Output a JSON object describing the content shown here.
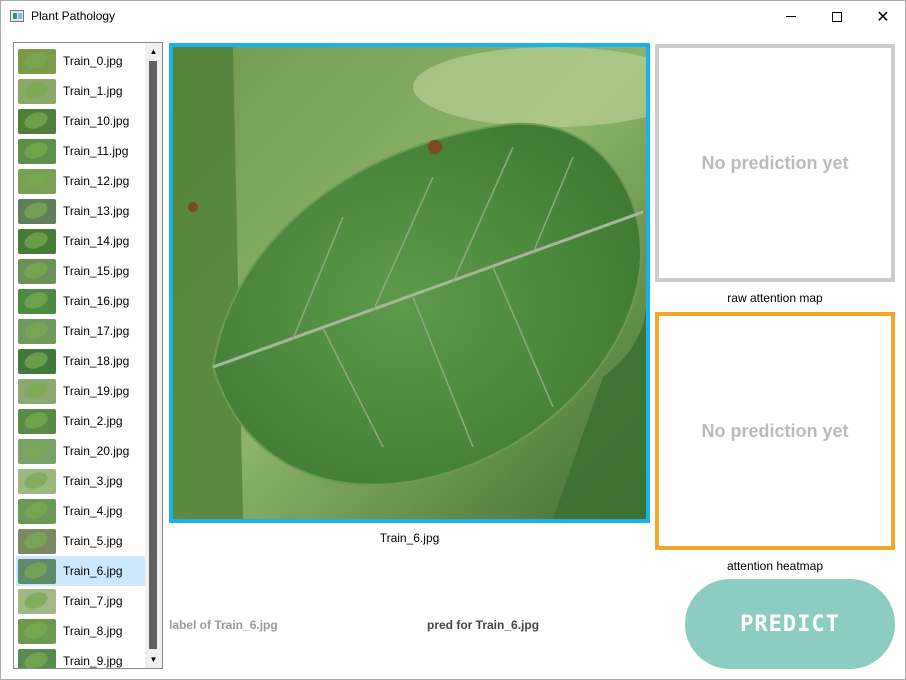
{
  "window": {
    "title": "Plant Pathology"
  },
  "file_list": {
    "items": [
      {
        "label": "Train_0.jpg",
        "thumb_color": "#7a9a4a"
      },
      {
        "label": "Train_1.jpg",
        "thumb_color": "#8aa86a"
      },
      {
        "label": "Train_10.jpg",
        "thumb_color": "#4f7f3a"
      },
      {
        "label": "Train_11.jpg",
        "thumb_color": "#5d8f4a"
      },
      {
        "label": "Train_12.jpg",
        "thumb_color": "#7aa055"
      },
      {
        "label": "Train_13.jpg",
        "thumb_color": "#5f7f5a"
      },
      {
        "label": "Train_14.jpg",
        "thumb_color": "#467a35"
      },
      {
        "label": "Train_15.jpg",
        "thumb_color": "#6a9258"
      },
      {
        "label": "Train_16.jpg",
        "thumb_color": "#4d8a42"
      },
      {
        "label": "Train_17.jpg",
        "thumb_color": "#6f9a5c"
      },
      {
        "label": "Train_18.jpg",
        "thumb_color": "#3f7a3c"
      },
      {
        "label": "Train_19.jpg",
        "thumb_color": "#8aa870"
      },
      {
        "label": "Train_2.jpg",
        "thumb_color": "#5a8a48"
      },
      {
        "label": "Train_20.jpg",
        "thumb_color": "#7aa268"
      },
      {
        "label": "Train_3.jpg",
        "thumb_color": "#9ab880"
      },
      {
        "label": "Train_4.jpg",
        "thumb_color": "#6a9a55"
      },
      {
        "label": "Train_5.jpg",
        "thumb_color": "#7a8a60"
      },
      {
        "label": "Train_6.jpg",
        "thumb_color": "#5e8a6a"
      },
      {
        "label": "Train_7.jpg",
        "thumb_color": "#a0b888"
      },
      {
        "label": "Train_8.jpg",
        "thumb_color": "#6e9a50"
      },
      {
        "label": "Train_9.jpg",
        "thumb_color": "#5a8a50"
      }
    ],
    "selected_label": "Train_6.jpg"
  },
  "main_image": {
    "caption": "Train_6.jpg"
  },
  "raw_attention": {
    "placeholder": "No prediction yet",
    "caption": "raw attention map",
    "border_color": "#cccccc"
  },
  "heatmap": {
    "placeholder": "No prediction yet",
    "caption": "attention heatmap",
    "border_color": "#f5a623"
  },
  "bottom": {
    "label_text": "label of Train_6.jpg",
    "pred_text": "pred for Train_6.jpg",
    "predict_label": "PREDICT"
  },
  "colors": {
    "image_border": "#19b3ec",
    "predict_button": "#8bcdc2",
    "selection": "#cce8ff"
  }
}
